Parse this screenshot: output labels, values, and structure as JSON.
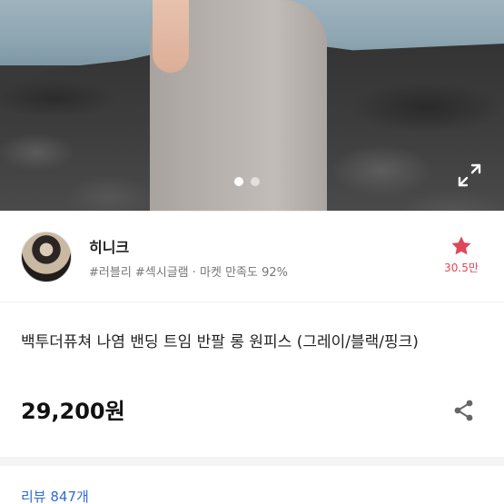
{
  "gallery": {
    "total_images": 2,
    "current_index": 1
  },
  "seller": {
    "name": "히니크",
    "tags": "#러블리 #섹시글램 · 마켓 만족도 92%",
    "favorite_count": "30.5만"
  },
  "product": {
    "title": "백투더퓨쳐 나염 밴딩 트임 반팔 롱 원피스 (그레이/블랙/핑크)",
    "price": "29,200원"
  },
  "reviews": {
    "label": "리뷰 847개"
  },
  "icons": {
    "favorite": "star-icon",
    "share": "share-icon",
    "expand": "expand-icon"
  },
  "colors": {
    "accent": "#e0475a",
    "link": "#2e6cd1"
  }
}
